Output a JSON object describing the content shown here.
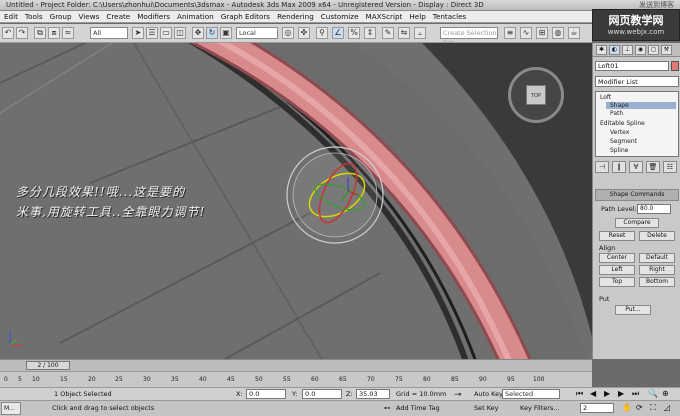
{
  "window": {
    "title": "Untitled    - Project Folder: C:\\Users\\zhonhui\\Documents\\3dsmax    - Autodesk 3ds Max  2009 x64    - Unregistered Version    - Display : Direct 3D",
    "watermark_top": "发送到博客"
  },
  "menu": [
    "Edit",
    "Tools",
    "Group",
    "Views",
    "Create",
    "Modifiers",
    "Animation",
    "Graph Editors",
    "Rendering",
    "Customize",
    "MAXScript",
    "Help",
    "Tentacles"
  ],
  "site_logo": {
    "line1": "网页教学网",
    "line2": "www.webjx.com"
  },
  "toolbar": {
    "selection_filter": "All",
    "reference_coord": "Local",
    "named_selection": "Create Selection Set"
  },
  "viewport": {
    "label": "",
    "viewcube_label": "TOP",
    "caption_line1": "多分几段效果!!哦...这是要的",
    "caption_line2": "米事,用旋转工具..全靠眼力调节!"
  },
  "command_panel": {
    "object_name": "Loft01",
    "modifier_list": "Modifier List",
    "stack": [
      {
        "label": "Loft",
        "level": 0,
        "selected": false
      },
      {
        "label": "Shape",
        "level": 1,
        "selected": true
      },
      {
        "label": "Path",
        "level": 1,
        "selected": false
      },
      {
        "label": "Editable Spline",
        "level": 0,
        "selected": false
      },
      {
        "label": "Vertex",
        "level": 1,
        "selected": false
      },
      {
        "label": "Segment",
        "level": 1,
        "selected": false
      },
      {
        "label": "Spline",
        "level": 1,
        "selected": false
      }
    ],
    "rollout_title": "Shape Commands",
    "path_level_label": "Path Level:",
    "path_level_value": "80.0",
    "compare": "Compare",
    "reset": "Reset",
    "delete": "Delete",
    "align_label": "Align",
    "center": "Center",
    "default": "Default",
    "left": "Left",
    "right": "Right",
    "top": "Top",
    "bottom": "Bottom",
    "put_label": "Put",
    "put_button": "Put..."
  },
  "timeline": {
    "frame": "2 / 100",
    "ticks": [
      "0",
      "5",
      "10",
      "15",
      "20",
      "25",
      "30",
      "35",
      "40",
      "45",
      "50",
      "55",
      "60",
      "65",
      "70",
      "75",
      "80",
      "85",
      "90",
      "95",
      "100"
    ]
  },
  "status": {
    "taskbar": "M...",
    "selection_info": "1 Object Selected",
    "prompt": "Click and drag to select objects",
    "x_label": "X:",
    "x_value": "0.0",
    "y_label": "Y:",
    "y_value": "0.0",
    "z_label": "Z:",
    "z_value": "35.03",
    "grid": "Grid = 10.0mm",
    "add_time_tag": "Add Time Tag",
    "auto_key": "Auto Key",
    "set_key": "Set Key",
    "key_mode": "Selected",
    "key_filters": "Key Filters...",
    "current_frame": "2"
  },
  "colors": {
    "pipe": "#d88a8c",
    "pipe_shadow": "#a35a5e",
    "plane": "#7a7a7a",
    "plane_dark": "#5a5a5a",
    "background": "#3a3a3a"
  }
}
